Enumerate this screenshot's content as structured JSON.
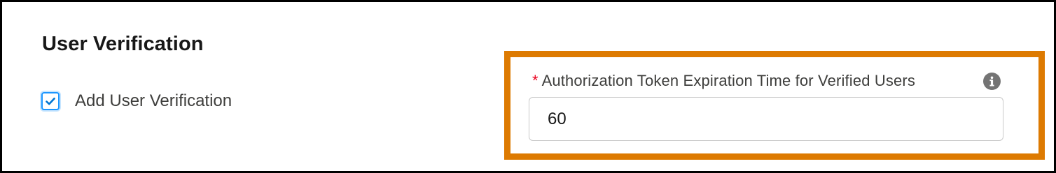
{
  "section": {
    "title": "User Verification"
  },
  "checkbox": {
    "label": "Add User Verification",
    "checked": true,
    "icon": "checkmark-icon",
    "accent_color": "#1b96ff"
  },
  "field": {
    "required_marker": "*",
    "label": "Authorization Token Expiration Time for Verified Users",
    "value": "60",
    "info_icon": "info-icon"
  },
  "highlight": {
    "color": "#dd7a01"
  }
}
